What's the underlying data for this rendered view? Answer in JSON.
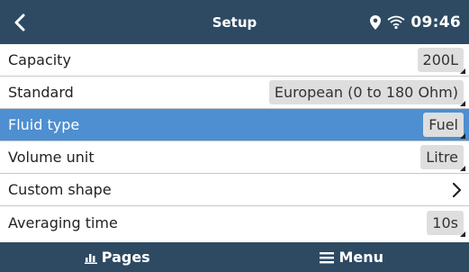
{
  "header": {
    "title": "Setup",
    "time": "09:46",
    "back_icon": "chevron-left-icon",
    "location_icon": "location-pin-icon",
    "wifi_icon": "wifi-icon"
  },
  "rows": [
    {
      "label": "Capacity",
      "value": "200L"
    },
    {
      "label": "Standard",
      "value": "European (0 to 180 Ohm)"
    },
    {
      "label": "Fluid type",
      "value": "Fuel",
      "selected": true
    },
    {
      "label": "Volume unit",
      "value": "Litre"
    },
    {
      "label": "Custom shape",
      "icon": "chevron-right-icon"
    },
    {
      "label": "Averaging time",
      "value": "10s"
    }
  ],
  "footer": {
    "pages_label": "Pages",
    "menu_label": "Menu",
    "pages_icon": "bar-chart-icon",
    "menu_icon": "hamburger-menu-icon"
  },
  "colors": {
    "header_bg": "#2e4a63",
    "selected_row_bg": "#4d8fd0",
    "value_bg": "#dedede"
  }
}
